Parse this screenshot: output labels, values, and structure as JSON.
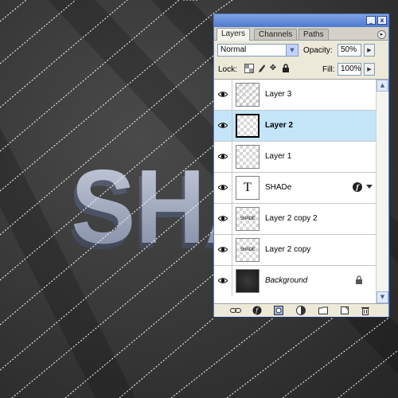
{
  "canvas": {
    "artwork_text": "SHA",
    "background_color": "#3a3a3a",
    "text_color": "#9fa9bf"
  },
  "panel": {
    "tabs": [
      {
        "label": "Layers",
        "active": true
      },
      {
        "label": "Channels",
        "active": false
      },
      {
        "label": "Paths",
        "active": false
      }
    ],
    "title_buttons": {
      "minimize": "_",
      "close": "x"
    },
    "menu_icon": "▸",
    "blend_mode": "Normal",
    "opacity_label": "Opacity:",
    "opacity_value": "50%",
    "lock_label": "Lock:",
    "fill_label": "Fill:",
    "fill_value": "100%",
    "selection_color": "#c4e4f8"
  },
  "layers": [
    {
      "name": "Layer 3",
      "visible": true,
      "selected": false,
      "thumb": "lines"
    },
    {
      "name": "Layer 2",
      "visible": true,
      "selected": true,
      "thumb": "transparent"
    },
    {
      "name": "Layer 1",
      "visible": true,
      "selected": false,
      "thumb": "transparent"
    },
    {
      "name": "SHADe",
      "visible": true,
      "selected": false,
      "thumb": "text",
      "thumb_glyph": "T",
      "has_effects": true
    },
    {
      "name": "Layer 2 copy 2",
      "visible": true,
      "selected": false,
      "thumb": "mini-text",
      "thumb_text": "SHADE"
    },
    {
      "name": "Layer 2 copy",
      "visible": true,
      "selected": false,
      "thumb": "mini-text",
      "thumb_text": "SHADE"
    },
    {
      "name": "Background",
      "visible": true,
      "selected": false,
      "thumb": "background",
      "locked": true
    }
  ],
  "bottom_icons": [
    "link-icon",
    "fx-icon",
    "mask-icon",
    "adjustment-icon",
    "folder-icon",
    "new-layer-icon",
    "trash-icon"
  ]
}
